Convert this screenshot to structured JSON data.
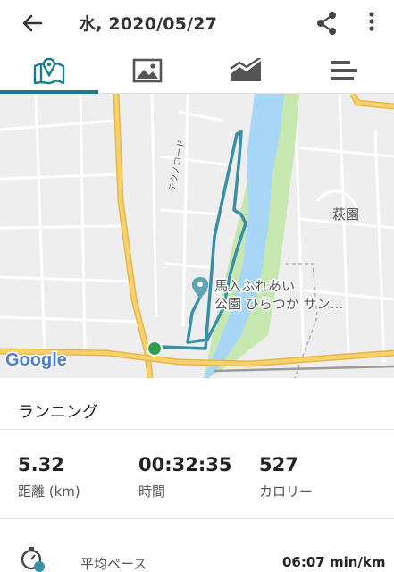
{
  "header": {
    "title": "水, 2020/05/27",
    "back_icon": "arrow-back-icon",
    "share_icon": "share-icon",
    "more_icon": "more-vert-icon"
  },
  "tabs": [
    {
      "icon": "map-pin-icon",
      "selected": true
    },
    {
      "icon": "photo-icon",
      "selected": false
    },
    {
      "icon": "chart-icon",
      "selected": false
    },
    {
      "icon": "list-icon",
      "selected": false
    }
  ],
  "map": {
    "road_label": "テクノロード",
    "area_label": "萩園",
    "place_label_line1": "馬入ふれあい",
    "place_label_line2": "公園 ひらつか サン…",
    "logo_text": "Google",
    "route_color": "#3a8fa8",
    "river_color": "#a8d6f7",
    "park_color": "#c6e8b0"
  },
  "activity": {
    "type": "ランニング"
  },
  "stats": [
    {
      "value": "5.32",
      "label": "距離 (km)"
    },
    {
      "value": "00:32:35",
      "label": "時間"
    },
    {
      "value": "527",
      "label": "カロリー"
    }
  ],
  "pace": {
    "label": "平均ペース",
    "value": "06:07 min/km"
  },
  "colors": {
    "accent": "#1a7c8c"
  }
}
